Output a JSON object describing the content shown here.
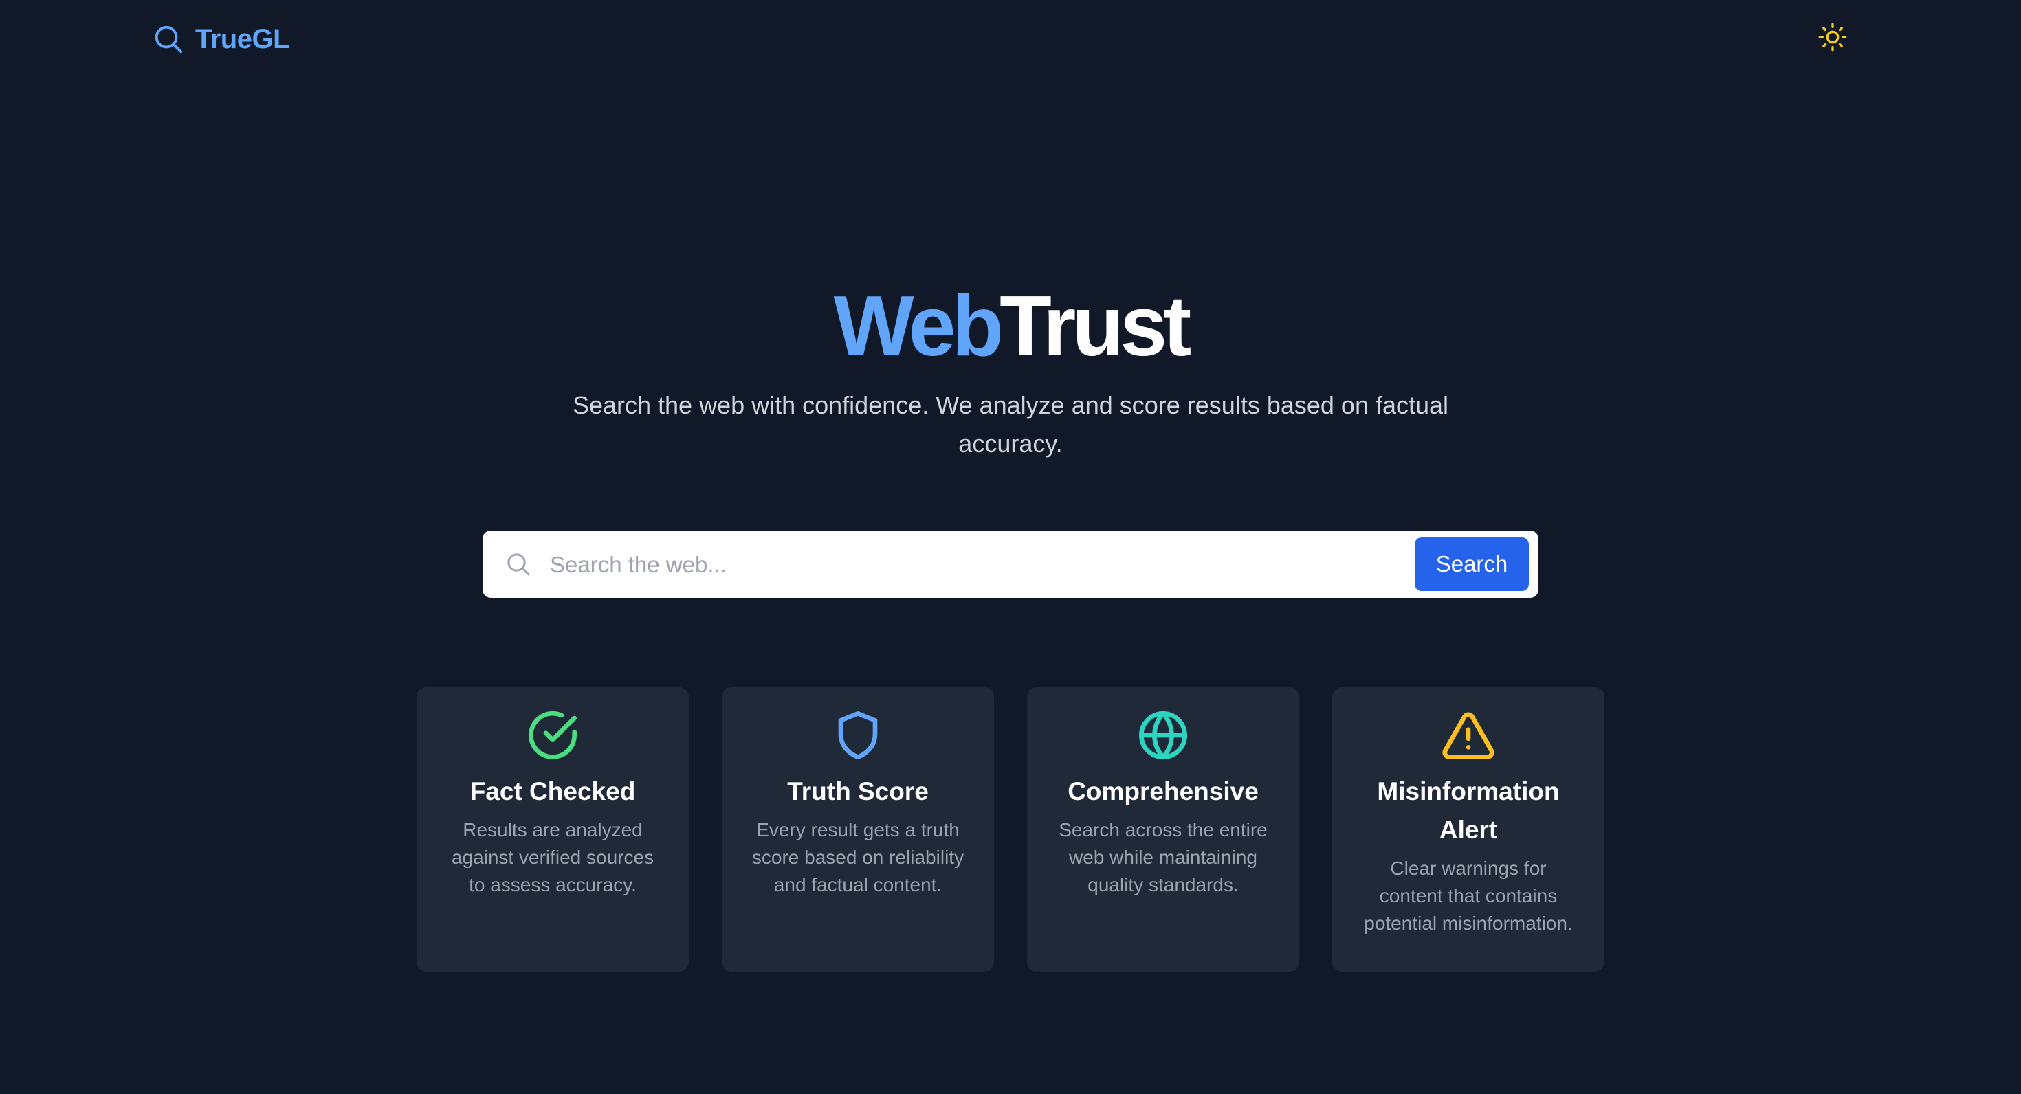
{
  "header": {
    "brand": "TrueGL",
    "theme_toggle_icon": "sun-icon"
  },
  "hero": {
    "title_part1": "Web",
    "title_part2": "Trust",
    "subtitle": "Search the web with confidence. We analyze and score results based on factual accuracy."
  },
  "search": {
    "placeholder": "Search the web...",
    "value": "",
    "button_label": "Search"
  },
  "features": [
    {
      "icon": "check-circle-icon",
      "color": "#4ade80",
      "title": "Fact Checked",
      "description": "Results are analyzed against verified sources to assess accuracy."
    },
    {
      "icon": "shield-icon",
      "color": "#60a5fa",
      "title": "Truth Score",
      "description": "Every result gets a truth score based on reliability and factual content."
    },
    {
      "icon": "globe-icon",
      "color": "#2dd4bf",
      "title": "Comprehensive",
      "description": "Search across the entire web while maintaining quality standards."
    },
    {
      "icon": "warning-triangle-icon",
      "color": "#fbbf24",
      "title": "Misinformation Alert",
      "description": "Clear warnings for content that contains potential misinformation."
    }
  ],
  "colors": {
    "background": "#111827",
    "card": "#1f2937",
    "accent": "#60a5fa",
    "button": "#2563eb"
  }
}
